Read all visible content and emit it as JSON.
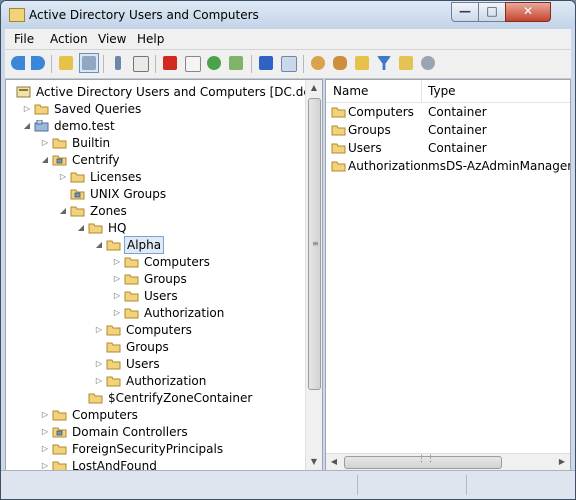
{
  "window": {
    "title": "Active Directory Users and Computers"
  },
  "window_buttons": {
    "minimize": "—",
    "maximize": "□",
    "close": "✕"
  },
  "menu": [
    "File",
    "Action",
    "View",
    "Help"
  ],
  "toolbar": {
    "icons": [
      "back-icon",
      "forward-icon",
      "up-folder-icon",
      "show-console-tree-icon",
      "cut-icon",
      "copy-icon",
      "delete-icon",
      "properties-icon",
      "refresh-icon",
      "export-list-icon",
      "help-icon",
      "show-pane-icon",
      "new-user-icon",
      "new-group-icon",
      "new-ou-icon",
      "filter-icon",
      "find-icon",
      "add-to-group-icon"
    ]
  },
  "tree": [
    {
      "label": "Active Directory Users and Computers [DC.demo.test]",
      "indent": 0,
      "expander": "",
      "icon": "snapin-root-icon"
    },
    {
      "label": "Saved Queries",
      "indent": 1,
      "expander": "▷",
      "icon": "folder-icon"
    },
    {
      "label": "demo.test",
      "indent": 1,
      "expander": "◢",
      "icon": "domain-icon"
    },
    {
      "label": "Builtin",
      "indent": 2,
      "expander": "▷",
      "icon": "folder-icon"
    },
    {
      "label": "Centrify",
      "indent": 2,
      "expander": "◢",
      "icon": "ou-icon"
    },
    {
      "label": "Licenses",
      "indent": 3,
      "expander": "▷",
      "icon": "folder-icon"
    },
    {
      "label": "UNIX Groups",
      "indent": 3,
      "expander": "",
      "icon": "ou-icon"
    },
    {
      "label": "Zones",
      "indent": 3,
      "expander": "◢",
      "icon": "folder-icon"
    },
    {
      "label": "HQ",
      "indent": 4,
      "expander": "◢",
      "icon": "folder-icon"
    },
    {
      "label": "Alpha",
      "indent": 5,
      "expander": "◢",
      "icon": "folder-icon",
      "selected": true
    },
    {
      "label": "Computers",
      "indent": 6,
      "expander": "▷",
      "icon": "folder-icon"
    },
    {
      "label": "Groups",
      "indent": 6,
      "expander": "▷",
      "icon": "folder-icon"
    },
    {
      "label": "Users",
      "indent": 6,
      "expander": "▷",
      "icon": "folder-icon"
    },
    {
      "label": "Authorization",
      "indent": 6,
      "expander": "▷",
      "icon": "folder-icon"
    },
    {
      "label": "Computers",
      "indent": 5,
      "expander": "▷",
      "icon": "folder-icon"
    },
    {
      "label": "Groups",
      "indent": 5,
      "expander": "",
      "icon": "folder-icon"
    },
    {
      "label": "Users",
      "indent": 5,
      "expander": "▷",
      "icon": "folder-icon"
    },
    {
      "label": "Authorization",
      "indent": 5,
      "expander": "▷",
      "icon": "folder-icon"
    },
    {
      "label": "$CentrifyZoneContainer",
      "indent": 4,
      "expander": "",
      "icon": "folder-icon"
    },
    {
      "label": "Computers",
      "indent": 2,
      "expander": "▷",
      "icon": "folder-icon"
    },
    {
      "label": "Domain Controllers",
      "indent": 2,
      "expander": "▷",
      "icon": "ou-icon"
    },
    {
      "label": "ForeignSecurityPrincipals",
      "indent": 2,
      "expander": "▷",
      "icon": "folder-icon"
    },
    {
      "label": "LostAndFound",
      "indent": 2,
      "expander": "▷",
      "icon": "folder-icon"
    }
  ],
  "list": {
    "columns": [
      "Name",
      "Type"
    ],
    "rows": [
      {
        "name": "Computers",
        "type": "Container"
      },
      {
        "name": "Groups",
        "type": "Container"
      },
      {
        "name": "Users",
        "type": "Container"
      },
      {
        "name": "Authorization",
        "type": "msDS-AzAdminManager"
      }
    ]
  },
  "colors": {
    "folder": "#f2d27a",
    "folder_edge": "#b08a2e",
    "selection": "#dfeaf7"
  }
}
